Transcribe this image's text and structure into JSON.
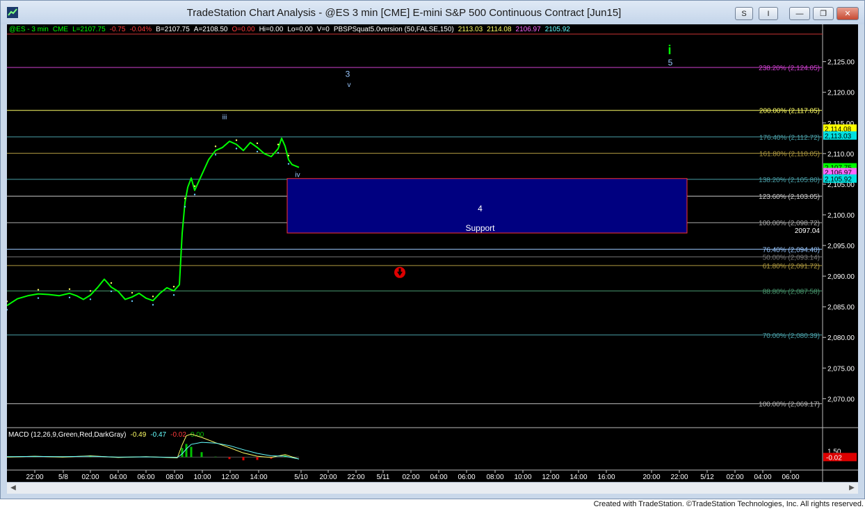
{
  "window": {
    "title": "TradeStation Chart Analysis - @ES 3 min [CME] E-mini S&P 500 Continuous Contract [Jun15]",
    "buttons": {
      "s": "S",
      "i": "I",
      "minimize": "—",
      "restore": "❐",
      "close": "✕"
    }
  },
  "credit": "Created with TradeStation. ©TradeStation Technologies, Inc. All rights reserved.",
  "colors": {
    "background": "#000000",
    "price": "#00ff00",
    "zone": "#000080",
    "zone_border": "#ff3333"
  },
  "status": [
    {
      "text": "@ES - 3 min",
      "color": "#00ff00"
    },
    {
      "text": "CME",
      "color": "#00ff00"
    },
    {
      "text": "L=2107.75",
      "color": "#00ff00"
    },
    {
      "text": "-0.75",
      "color": "#ff3b3b"
    },
    {
      "text": "-0.04%",
      "color": "#ff3b3b"
    },
    {
      "text": "B=2107.75",
      "color": "#ffffff"
    },
    {
      "text": "A=2108.50",
      "color": "#ffffff"
    },
    {
      "text": "O=0.00",
      "color": "#ff3b3b"
    },
    {
      "text": "Hi=0.00",
      "color": "#ffffff"
    },
    {
      "text": "Lo=0.00",
      "color": "#ffffff"
    },
    {
      "text": "V=0",
      "color": "#ffffff"
    },
    {
      "text": "PBSPSquat5.0version (50,FALSE,150)",
      "color": "#ffffff"
    },
    {
      "text": "2113.03",
      "color": "#ffff66"
    },
    {
      "text": "2114.08",
      "color": "#ffff66"
    },
    {
      "text": "2106.97",
      "color": "#ff66ff"
    },
    {
      "text": "2105.92",
      "color": "#66ffff"
    }
  ],
  "macd_status": [
    {
      "text": "MACD (12,26,9,Green,Red,DarkGray)",
      "color": "#ffffff"
    },
    {
      "text": "-0.49",
      "color": "#ffff66"
    },
    {
      "text": "-0.47",
      "color": "#66ffff"
    },
    {
      "text": "-0.02",
      "color": "#ff3b3b"
    },
    {
      "text": "0.00",
      "color": "#00c000"
    }
  ],
  "chart_data": {
    "type": "line",
    "symbol": "@ES - 3 min",
    "ylim": [
      2065.5,
      2129.5
    ],
    "yticks": [
      2070,
      2075,
      2080,
      2085,
      2090,
      2095,
      2100,
      2105,
      2110,
      2115,
      2120,
      2125
    ],
    "ytick_labels": [
      "2,070.00",
      "2,075.00",
      "2,080.00",
      "2,085.00",
      "2,090.00",
      "2,095.00",
      "2,100.00",
      "2,105.00",
      "2,110.00",
      "2,115.00",
      "2,120.00",
      "2,125.00"
    ],
    "xlabels": [
      "22:00",
      "5/8",
      "02:00",
      "04:00",
      "06:00",
      "08:00",
      "10:00",
      "12:00",
      "14:00",
      "5/10",
      "20:00",
      "22:00",
      "5/11",
      "02:00",
      "04:00",
      "06:00",
      "08:00",
      "10:00",
      "12:00",
      "14:00",
      "16:00",
      "20:00",
      "22:00",
      "5/12",
      "02:00",
      "04:00",
      "06:00"
    ],
    "xlim": [
      0,
      1170
    ],
    "xlabel_positions": [
      40,
      81,
      120,
      160,
      200,
      241,
      281,
      321,
      362,
      423,
      462,
      502,
      541,
      581,
      621,
      661,
      702,
      742,
      782,
      822,
      862,
      927,
      967,
      1007,
      1047,
      1087,
      1127
    ],
    "price_series": {
      "x": [
        0,
        15,
        30,
        45,
        60,
        75,
        90,
        100,
        110,
        120,
        130,
        140,
        150,
        160,
        170,
        180,
        190,
        200,
        210,
        220,
        230,
        240,
        248,
        252,
        256,
        260,
        265,
        270,
        280,
        290,
        300,
        310,
        320,
        330,
        340,
        350,
        360,
        370,
        380,
        390,
        395,
        400,
        405,
        410,
        420
      ],
      "y": [
        2085.2,
        2086.3,
        2086.8,
        2087.1,
        2087.0,
        2086.8,
        2087.2,
        2086.8,
        2086.2,
        2086.9,
        2088.1,
        2089.5,
        2088.2,
        2087.5,
        2086.2,
        2086.6,
        2087.2,
        2086.4,
        2086.0,
        2087.2,
        2088.1,
        2087.6,
        2088.6,
        2097.0,
        2102.0,
        2104.5,
        2106.0,
        2104.0,
        2106.5,
        2109.0,
        2110.5,
        2111.0,
        2112.0,
        2111.5,
        2110.5,
        2111.8,
        2111.0,
        2110.0,
        2109.5,
        2110.8,
        2112.5,
        2111.2,
        2109.0,
        2108.2,
        2107.75
      ]
    },
    "fib_levels": [
      {
        "label": "238.20% (2,124.05)",
        "value": 2124.05,
        "color": "#d040d0"
      },
      {
        "label": "200.00% (2,117.05)",
        "value": 2117.05,
        "color": "#ffff66"
      },
      {
        "label": "176.40% (2,112.72)",
        "value": 2112.72,
        "color": "#4aa0a8"
      },
      {
        "label": "161.80% (2,110.05)",
        "value": 2110.05,
        "color": "#b09a40"
      },
      {
        "label": "138.20% (2,105.80)",
        "value": 2105.8,
        "color": "#4aa0a8"
      },
      {
        "label": "123.60% (2,103.05)",
        "value": 2103.05,
        "color": "#cccccc"
      },
      {
        "label": "100.00% (2,098.72)",
        "value": 2098.72,
        "color": "#aaaaaa"
      },
      {
        "label": "76.40% (2,094.40)",
        "value": 2094.4,
        "color": "#9ac8ff"
      },
      {
        "label": "50.00% (2,093.14)",
        "value": 2093.14,
        "color": "#777777"
      },
      {
        "label": "61.80% (2,091.72)",
        "value": 2091.72,
        "color": "#b09a40"
      },
      {
        "label": "88.80% (2,087.58)",
        "value": 2087.58,
        "color": "#4a9a70"
      },
      {
        "label": "70.00% (2,080.39)",
        "value": 2080.39,
        "color": "#4aa0a8"
      },
      {
        "label": "100.00% (2,069.17)",
        "value": 2069.17,
        "color": "#bbbbbb"
      }
    ],
    "support_zone": {
      "label_top": "4",
      "label_bottom": "Support",
      "x_start": 403,
      "x_end": 978,
      "y_low": 2097.04,
      "y_high": 2105.92,
      "edge_label": "2097.04"
    },
    "wave_labels": [
      {
        "text": "3",
        "x": 490,
        "y": 2122.5,
        "color": "#9ac8ff"
      },
      {
        "text": "v",
        "x": 492,
        "y": 2120.9,
        "color": "#9ac8ff"
      },
      {
        "text": "iii",
        "x": 313,
        "y": 2115.6,
        "color": "#9ac8ff"
      },
      {
        "text": "iv",
        "x": 418,
        "y": 2106.2,
        "color": "#9ac8ff"
      },
      {
        "text": "i",
        "x": 953,
        "y": 2126.2,
        "color": "#00ff00"
      },
      {
        "text": "5",
        "x": 954,
        "y": 2124.4,
        "color": "#9ac8ff"
      }
    ],
    "down_arrow_marker": {
      "x": 565,
      "y": 2090.6
    },
    "price_tags": [
      {
        "text": "2,114.08",
        "value": 2114.08,
        "bg": "#ffff00",
        "fg": "#000000"
      },
      {
        "text": "2,113.03",
        "value": 2112.95,
        "bg": "#00e0e0",
        "fg": "#000000"
      },
      {
        "text": "2,107.75",
        "value": 2107.75,
        "bg": "#00ff00",
        "fg": "#000000"
      },
      {
        "text": "2,106.97",
        "value": 2106.97,
        "bg": "#ff66ff",
        "fg": "#000000"
      },
      {
        "text": "2,105.92",
        "value": 2105.92,
        "bg": "#00e0e0",
        "fg": "#000000"
      }
    ],
    "macd": {
      "ytick_label": "1.50",
      "ylim": [
        -3,
        6.5
      ],
      "value_tag": "-0.02",
      "line_x": [
        0,
        40,
        80,
        120,
        160,
        200,
        245,
        252,
        258,
        265,
        280,
        300,
        320,
        340,
        360,
        380,
        400,
        420
      ],
      "macd": [
        0.0,
        0.2,
        0.0,
        0.3,
        -0.1,
        0.1,
        -0.2,
        3.0,
        5.2,
        5.6,
        4.8,
        3.5,
        2.3,
        1.0,
        0.2,
        -0.1,
        0.6,
        -0.49
      ],
      "signal": [
        0.1,
        0.15,
        0.1,
        0.2,
        0.0,
        0.05,
        -0.1,
        0.8,
        2.0,
        3.1,
        3.6,
        3.4,
        2.8,
        1.8,
        0.9,
        0.3,
        0.2,
        -0.47
      ]
    }
  }
}
